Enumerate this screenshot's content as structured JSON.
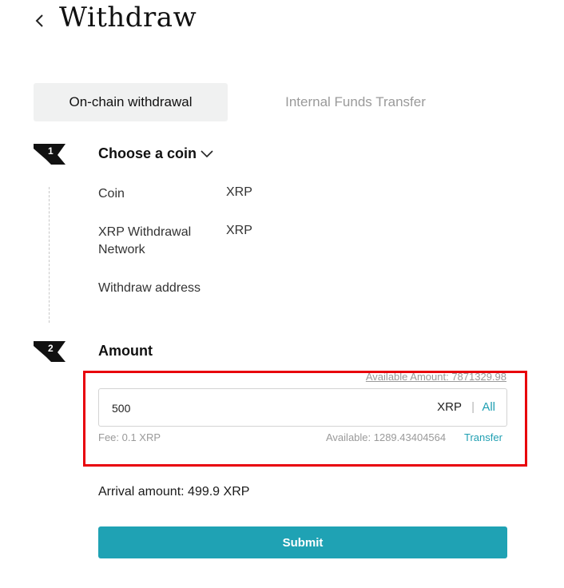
{
  "header": {
    "title": "Withdraw",
    "back_icon": "chevron-left-icon"
  },
  "tabs": [
    {
      "label": "On-chain withdrawal",
      "active": true
    },
    {
      "label": "Internal Funds Transfer",
      "active": false
    }
  ],
  "step1": {
    "number": "1",
    "title": "Choose a coin",
    "dropdown_icon": "chevron-down-icon",
    "fields": [
      {
        "label": "Coin",
        "value": "XRP"
      },
      {
        "label": "XRP Withdrawal Network",
        "value": "XRP"
      },
      {
        "label": "Withdraw address",
        "value": ""
      }
    ]
  },
  "step2": {
    "number": "2",
    "title": "Amount",
    "available_amount": "Available Amount: 7871329.98",
    "input_value": "500",
    "unit": "XRP",
    "separator": "|",
    "all_label": "All",
    "fee": "Fee: 0.1 XRP",
    "available": "Available: 1289.43404564",
    "transfer_label": "Transfer"
  },
  "arrival": "Arrival amount: 499.9 XRP",
  "submit_label": "Submit",
  "colors": {
    "accent": "#1fa2b4",
    "highlight": "#e8000b",
    "step_flag": "#111111"
  }
}
